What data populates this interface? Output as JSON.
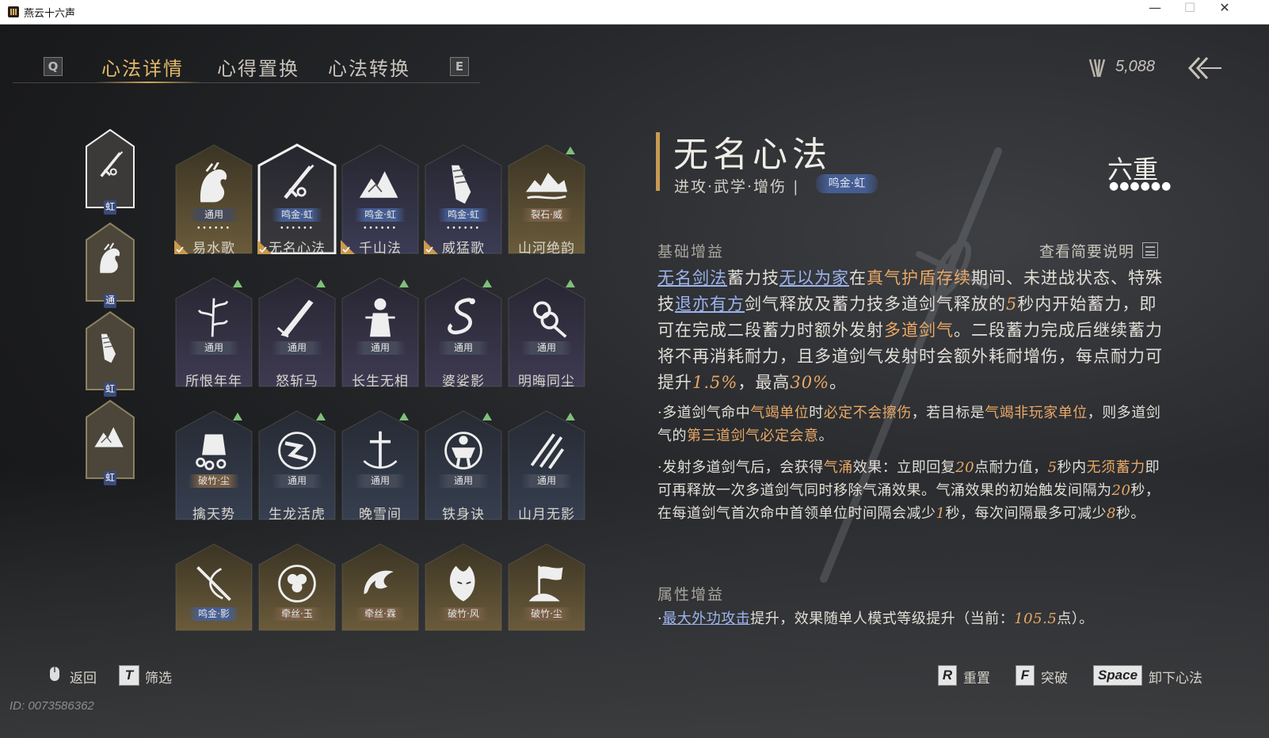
{
  "window": {
    "title": "燕云十六声",
    "minimize": "—",
    "maximize": "☐",
    "close": "✕"
  },
  "nav": {
    "key_left": "Q",
    "key_right": "E",
    "tabs": [
      "心法详情",
      "心得置换",
      "心法转换"
    ]
  },
  "currency": {
    "value": "5,088",
    "icon": "currency-icon"
  },
  "side_slots": [
    {
      "tag": "虹",
      "icon": "sword-icon",
      "selected": true
    },
    {
      "tag": "通",
      "icon": "horse-icon"
    },
    {
      "tag": "虹",
      "icon": "bound-fist-icon"
    },
    {
      "tag": "虹",
      "icon": "mountains-icon"
    }
  ],
  "grid": [
    {
      "name": "易水歌",
      "badge": "通用",
      "icon": "horse-icon",
      "dots": "••••••",
      "checked": true
    },
    {
      "name": "无名心法",
      "badge": "鸣金·虹",
      "icon": "sword-icon",
      "dots": "••••••",
      "checked": true,
      "selected": true
    },
    {
      "name": "千山法",
      "badge": "鸣金·虹",
      "icon": "mountains-icon",
      "dots": "••••••",
      "checked": true
    },
    {
      "name": "威猛歌",
      "badge": "鸣金·虹",
      "icon": "bound-fist-icon",
      "dots": "••••••",
      "checked": true
    },
    {
      "name": "山河绝韵",
      "badge": "裂石·威",
      "icon": "landscape-icon",
      "up": true
    },
    {
      "name": "所恨年年",
      "badge": "通用",
      "icon": "bamboo-icon",
      "up": true
    },
    {
      "name": "怒斩马",
      "badge": "通用",
      "icon": "blade-icon",
      "up": true
    },
    {
      "name": "长生无相",
      "badge": "通用",
      "icon": "statue-icon",
      "up": true
    },
    {
      "name": "婆娑影",
      "badge": "通用",
      "icon": "dragon-icon",
      "up": true
    },
    {
      "name": "明晦同尘",
      "badge": "通用",
      "icon": "knot-icon",
      "up": true
    },
    {
      "name": "擒天势",
      "badge": "破竹·尘",
      "icon": "chained-fist-icon",
      "up": true
    },
    {
      "name": "生龙活虎",
      "badge": "通用",
      "icon": "swirl-icon",
      "up": true
    },
    {
      "name": "晚雪间",
      "badge": "通用",
      "icon": "cross-sword-icon",
      "up": true
    },
    {
      "name": "铁身诀",
      "badge": "通用",
      "icon": "warrior-icon",
      "up": true
    },
    {
      "name": "山月无影",
      "badge": "通用",
      "icon": "slash-icon",
      "up": true
    },
    {
      "badge": "鸣金·影",
      "icon": "spear-icon"
    },
    {
      "badge": "牵丝·玉",
      "icon": "flower-icon"
    },
    {
      "badge": "牵丝·霖",
      "icon": "wave-icon"
    },
    {
      "badge": "破竹·风",
      "icon": "mask-icon"
    },
    {
      "badge": "破竹·尘",
      "icon": "flag-icon"
    }
  ],
  "detail": {
    "title": "无名心法",
    "tags": "进攻·武学·增伤 |",
    "grade_tag": "鸣金·虹",
    "level": "六重",
    "level_dots": "●●●●●●",
    "section_base": "基础增益",
    "brief_link": "查看简要说明",
    "section_attr": "属性增益",
    "main": {
      "t1": "无名剑法",
      "t2": "蓄力技",
      "t3": "无以为家",
      "t4": "在",
      "t5": "真气护盾存续",
      "t6": "期间、未进战状态、特殊技",
      "t7": "退亦有方",
      "t8": "剑气释放及蓄力技多道剑气释放的",
      "t9": "5",
      "t10": "秒内开始蓄力，即可在完成二段蓄力时额外发射",
      "t11": "多道剑气",
      "t12": "。二段蓄力完成后继续蓄力将不再消耗耐力，且多道剑气发射时会额外耗耐增伤，每点耐力可提升",
      "t13": "1.5%",
      "t14": "，最高",
      "t15": "30%",
      "t16": "。"
    },
    "b1": {
      "t1": "·多道剑气命中",
      "t2": "气竭单位",
      "t3": "时",
      "t4": "必定不会擦伤",
      "t5": "，若目标是",
      "t6": "气竭非玩家单位",
      "t7": "，则多道剑气的",
      "t8": "第三道剑气必定会意",
      "t9": "。"
    },
    "b2": {
      "t1": "·发射多道剑气后，会获得",
      "t2": "气涌",
      "t3": "效果：立即回复",
      "t4": "20",
      "t5": "点耐力值，",
      "t6": "5",
      "t7": "秒内",
      "t8": "无须蓄力",
      "t9": "即可再释放一次多道剑气同时移除气涌效果。气涌效果的初始触发间隔为",
      "t10": "20",
      "t11": "秒，在每道剑气首次命中首领单位时间隔会减少",
      "t12": "1",
      "t13": "秒，每次间隔最多可减少",
      "t14": "8",
      "t15": "秒。"
    },
    "attr": {
      "t1": "·",
      "t2": "最大外功攻击",
      "t3": "提升，效果随单人模式等级提升（当前：",
      "t4": "105.5",
      "t5": "点）。"
    }
  },
  "footer": {
    "back": "返回",
    "filter_key": "T",
    "filter": "筛选",
    "reset_key": "R",
    "reset": "重置",
    "break_key": "F",
    "break": "突破",
    "unload_key": "Space",
    "unload": "卸下心法",
    "id": "ID: 0073586362"
  },
  "colors": {
    "accent": "#e4b86a",
    "highlight": "#e9a866",
    "link": "#9db4ee"
  }
}
